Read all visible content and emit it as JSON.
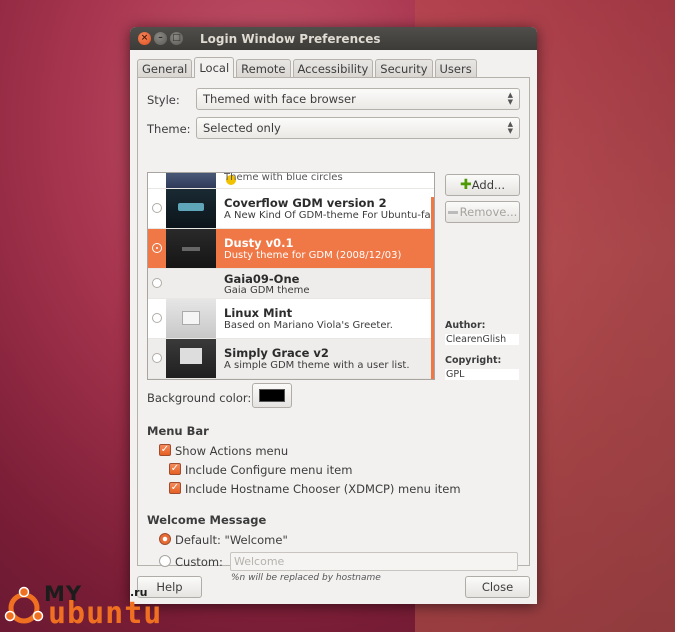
{
  "window": {
    "title": "Login Window Preferences"
  },
  "tabs": [
    "General",
    "Local",
    "Remote",
    "Accessibility",
    "Security",
    "Users"
  ],
  "active_tab": "Local",
  "style": {
    "label": "Style:",
    "value": "Themed with face browser"
  },
  "theme": {
    "label": "Theme:",
    "value": "Selected only"
  },
  "theme_list": {
    "partial_desc": "Theme with blue circles",
    "items": [
      {
        "name": "Coverflow GDM version 2",
        "desc": "A New Kind Of GDM-theme For Ubuntu-fans!"
      },
      {
        "name": "Dusty v0.1",
        "desc": "Dusty theme for GDM (2008/12/03)"
      },
      {
        "name": "Gaia09-One",
        "desc": "Gaia GDM theme"
      },
      {
        "name": "Linux Mint",
        "desc": "Based on Mariano Viola's Greeter."
      },
      {
        "name": "Simply Grace v2",
        "desc": "A simple GDM theme with a user list."
      }
    ],
    "selected_index": 1
  },
  "buttons": {
    "add": "Add...",
    "remove": "Remove...",
    "help": "Help",
    "close": "Close"
  },
  "info": {
    "author_label": "Author:",
    "author": "ClearenGlish",
    "copyright_label": "Copyright:",
    "copyright": "GPL"
  },
  "background_color": {
    "label": "Background color:",
    "value": "#000000"
  },
  "menu_bar": {
    "title": "Menu Bar",
    "show_actions": "Show Actions menu",
    "include_configure": "Include Configure menu item",
    "include_hostname": "Include Hostname Chooser (XDMCP) menu item"
  },
  "welcome": {
    "title": "Welcome Message",
    "default_label": "Default: \"Welcome\"",
    "custom_label": "Custom:",
    "custom_placeholder": "Welcome",
    "hint": "%n will be replaced by hostname"
  },
  "logo": {
    "my": "MY",
    "ru": ".ru",
    "ubuntu": "ubuntu"
  },
  "colors": {
    "accent": "#f07746",
    "titlebar": "#3c3b37"
  }
}
